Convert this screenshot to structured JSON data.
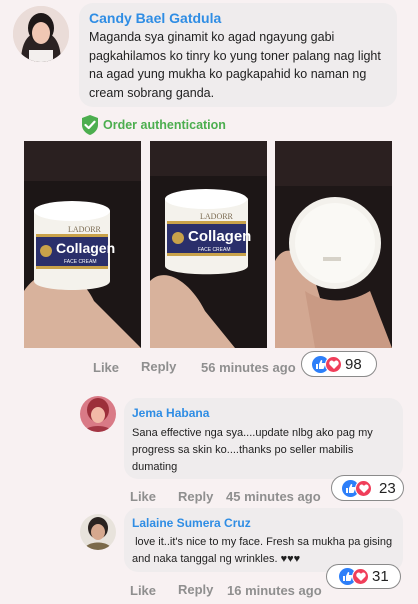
{
  "comment": {
    "author": "Candy Bael Gatdula",
    "text": "Maganda sya ginamit ko agad ngayung gabi pagkahilamos ko tinry ko yung toner palang nag light na agad yung mukha ko pagkapahid ko naman ng cream sobrang ganda.",
    "badge_label": "Order authentication",
    "jar_brand": "LADORR",
    "jar_product": "Collagen",
    "jar_sub": "FACE CREAM",
    "like_label": "Like",
    "reply_label": "Reply",
    "time": "56 minutes ago",
    "reaction_count": "98"
  },
  "replies": [
    {
      "author": "Jema Habana",
      "text": "Sana effective nga sya....update nlbg ako pag my progress sa skin ko....thanks po seller mabilis dumating",
      "like_label": "Like",
      "reply_label": "Reply",
      "time": "45 minutes ago",
      "reaction_count": "23"
    },
    {
      "author": "Lalaine Sumera Cruz",
      "text": " love it..it's nice to my face. Fresh sa mukha pa gising and naka tanggal ng wrinkles. ♥♥♥",
      "like_label": "Like",
      "reply_label": "Reply",
      "time": "16 minutes ago",
      "reaction_count": "31"
    }
  ],
  "colors": {
    "name_blue": "#2f8de4",
    "verified_green": "#4cae4f",
    "like_blue": "#2d7ff9",
    "love_red": "#f03e5a"
  }
}
